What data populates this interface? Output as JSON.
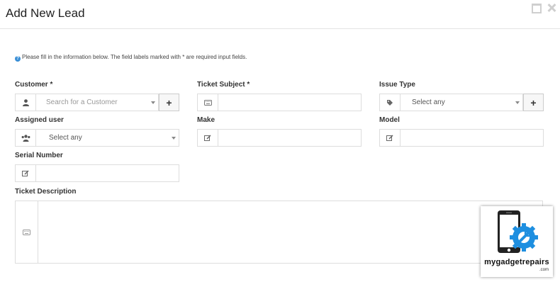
{
  "modal": {
    "title": "Add New Lead"
  },
  "info": {
    "text": "Please fill in the information below. The field labels marked with * are required input fields."
  },
  "fields": {
    "customer": {
      "label": "Customer *",
      "placeholder": "Search for a Customer",
      "addon_icon": "user-icon"
    },
    "ticket_subject": {
      "label": "Ticket Subject *",
      "value": "",
      "addon_icon": "keyboard-icon"
    },
    "issue_type": {
      "label": "Issue Type",
      "value": "Select any",
      "addon_icon": "tag-icon"
    },
    "assigned_user": {
      "label": "Assigned user",
      "value": "Select any",
      "addon_icon": "users-icon"
    },
    "make": {
      "label": "Make",
      "value": "",
      "addon_icon": "edit-icon"
    },
    "model": {
      "label": "Model",
      "value": "",
      "addon_icon": "edit-icon"
    },
    "serial_number": {
      "label": "Serial Number",
      "value": "",
      "addon_icon": "edit-icon"
    },
    "ticket_description": {
      "label": "Ticket Description",
      "value": "",
      "addon_icon": "keyboard-icon"
    }
  },
  "buttons": {
    "plus": "+"
  },
  "logo": {
    "text": "mygadgetrepairs",
    "sub": ".com",
    "colors": {
      "blue": "#1e8fe0",
      "dark": "#222222"
    }
  },
  "colors": {
    "info_icon": "#3a8fd6",
    "border": "#dddddd"
  }
}
